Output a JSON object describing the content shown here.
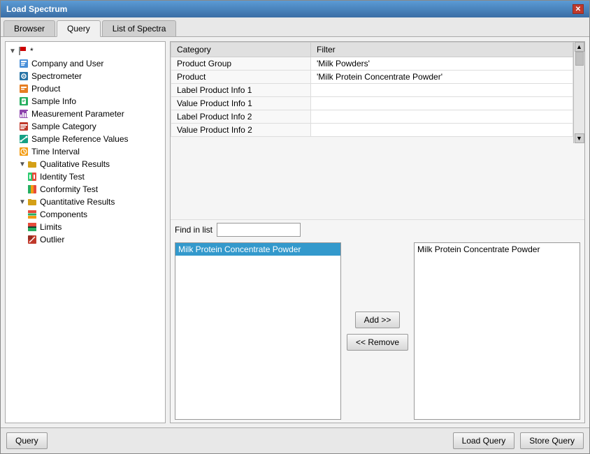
{
  "window": {
    "title": "Load Spectrum"
  },
  "tabs": [
    {
      "id": "browser",
      "label": "Browser"
    },
    {
      "id": "query",
      "label": "Query",
      "active": true
    },
    {
      "id": "list",
      "label": "List of Spectra"
    }
  ],
  "sidebar": {
    "root": "*",
    "items": [
      {
        "id": "company",
        "label": "Company and User",
        "level": 1,
        "icon": "user-icon"
      },
      {
        "id": "spectrometer",
        "label": "Spectrometer",
        "level": 1,
        "icon": "spectrometer-icon"
      },
      {
        "id": "product",
        "label": "Product",
        "level": 1,
        "icon": "product-icon"
      },
      {
        "id": "sample-info",
        "label": "Sample Info",
        "level": 1,
        "icon": "sample-icon"
      },
      {
        "id": "measurement",
        "label": "Measurement Parameter",
        "level": 1,
        "icon": "measurement-icon"
      },
      {
        "id": "category",
        "label": "Sample Category",
        "level": 1,
        "icon": "category-icon"
      },
      {
        "id": "reference",
        "label": "Sample Reference Values",
        "level": 1,
        "icon": "reference-icon"
      },
      {
        "id": "time",
        "label": "Time Interval",
        "level": 1,
        "icon": "time-icon"
      },
      {
        "id": "qualitative",
        "label": "Qualitative Results",
        "level": 1,
        "icon": "folder-icon",
        "expandable": true,
        "expanded": true
      },
      {
        "id": "identity",
        "label": "Identity Test",
        "level": 2,
        "icon": "identity-icon"
      },
      {
        "id": "conformity",
        "label": "Conformity Test",
        "level": 2,
        "icon": "conformity-icon"
      },
      {
        "id": "quantitative",
        "label": "Quantitative Results",
        "level": 1,
        "icon": "folder-icon",
        "expandable": true,
        "expanded": true
      },
      {
        "id": "components",
        "label": "Components",
        "level": 2,
        "icon": "components-icon"
      },
      {
        "id": "limits",
        "label": "Limits",
        "level": 2,
        "icon": "limits-icon"
      },
      {
        "id": "outlier",
        "label": "Outlier",
        "level": 2,
        "icon": "outlier-icon"
      }
    ]
  },
  "filter_table": {
    "headers": [
      "Category",
      "Filter"
    ],
    "rows": [
      {
        "category": "Product Group",
        "filter": "'Milk Powders'"
      },
      {
        "category": "Product",
        "filter": "'Milk Protein Concentrate Powder'"
      },
      {
        "category": "Label Product Info 1",
        "filter": ""
      },
      {
        "category": "Value Product Info 1",
        "filter": ""
      },
      {
        "category": "Label Product Info 2",
        "filter": ""
      },
      {
        "category": "Value Product Info 2",
        "filter": ""
      }
    ]
  },
  "find_in_list": {
    "label": "Find in list",
    "value": "",
    "placeholder": ""
  },
  "available_list": {
    "items": [
      {
        "id": "milk-protein",
        "label": "Milk Protein Concentrate Powder",
        "selected": true
      }
    ]
  },
  "selected_list": {
    "items": [
      {
        "id": "milk-protein-sel",
        "label": "Milk Protein Concentrate Powder"
      }
    ]
  },
  "buttons": {
    "add": "Add >>",
    "remove": "<< Remove",
    "query": "Query",
    "load_query": "Load Query",
    "store_query": "Store Query"
  },
  "colors": {
    "accent_blue": "#3399cc",
    "selected_row": "#3399cc"
  }
}
